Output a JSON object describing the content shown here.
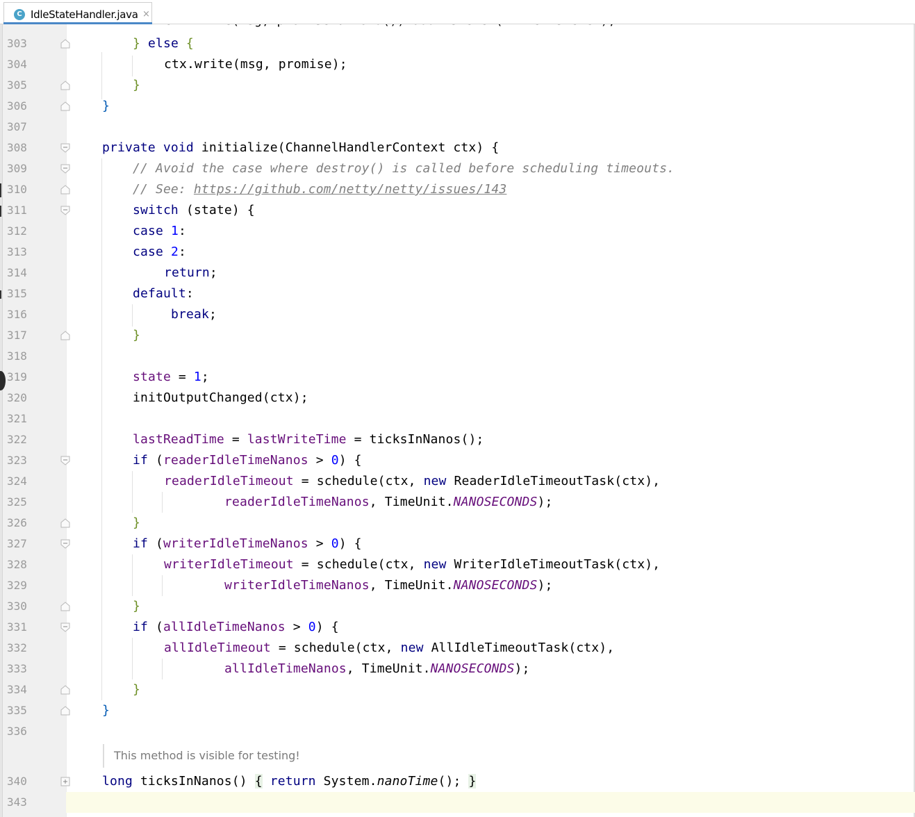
{
  "tab": {
    "icon": "class-icon",
    "icon_letter": "C",
    "file_name": "IdleStateHandler.java",
    "close_glyph": "×"
  },
  "editor": {
    "doc_comment": "This method is visible for testing!",
    "lines": [
      {
        "number": "303"
      },
      {
        "number": "304"
      },
      {
        "number": "305"
      },
      {
        "number": "306"
      },
      {
        "number": "307"
      },
      {
        "number": "308"
      },
      {
        "number": "309"
      },
      {
        "number": "310"
      },
      {
        "number": "311"
      },
      {
        "number": "312"
      },
      {
        "number": "313"
      },
      {
        "number": "314"
      },
      {
        "number": "315"
      },
      {
        "number": "316"
      },
      {
        "number": "317"
      },
      {
        "number": "318"
      },
      {
        "number": "319"
      },
      {
        "number": "320"
      },
      {
        "number": "321"
      },
      {
        "number": "322"
      },
      {
        "number": "323"
      },
      {
        "number": "324"
      },
      {
        "number": "325"
      },
      {
        "number": "326"
      },
      {
        "number": "327"
      },
      {
        "number": "328"
      },
      {
        "number": "329"
      },
      {
        "number": "330"
      },
      {
        "number": "331"
      },
      {
        "number": "332"
      },
      {
        "number": "333"
      },
      {
        "number": "334"
      },
      {
        "number": "335"
      },
      {
        "number": "336"
      },
      {
        "number": "340"
      },
      {
        "number": "343"
      }
    ],
    "code": {
      "l303_a": "} ",
      "l303_kw": "else",
      "l303_b": " {",
      "l304": "ctx.write(msg, promise);",
      "l305": "}",
      "l306": "}",
      "l308_kw1": "private",
      "l308_kw2": "void",
      "l308_rest": " initialize(ChannelHandlerContext ctx) {",
      "l309": "// Avoid the case where destroy() is called before scheduling timeouts.",
      "l310_a": "// See: ",
      "l310_link": "https://github.com/netty/netty/issues/143",
      "l311_kw": "switch",
      "l311_rest": " (state) {",
      "l312_kw": "case",
      "l312_num": "1",
      "l312_b": ":",
      "l313_kw": "case",
      "l313_num": "2",
      "l313_b": ":",
      "l314_kw": "return",
      "l314_b": ";",
      "l315_kw": "default",
      "l315_b": ":",
      "l316_kw": "break",
      "l316_b": ";",
      "l317": "}",
      "l319_fld": "state",
      "l319_a": " = ",
      "l319_num": "1",
      "l319_b": ";",
      "l320": "initOutputChanged(ctx);",
      "l322_f1": "lastReadTime",
      "l322_a": " = ",
      "l322_f2": "lastWriteTime",
      "l322_b": " = ticksInNanos();",
      "l323_kw": "if",
      "l323_a": " (",
      "l323_fld": "readerIdleTimeNanos",
      "l323_b": " > ",
      "l323_num": "0",
      "l323_c": ") {",
      "l324_fld": "readerIdleTimeout",
      "l324_a": " = schedule(ctx, ",
      "l324_kw": "new",
      "l324_b": " ReaderIdleTimeoutTask(ctx),",
      "l325_fld": "readerIdleTimeNanos",
      "l325_a": ", TimeUnit.",
      "l325_stat": "NANOSECONDS",
      "l325_b": ");",
      "l326": "}",
      "l327_kw": "if",
      "l327_a": " (",
      "l327_fld": "writerIdleTimeNanos",
      "l327_b": " > ",
      "l327_num": "0",
      "l327_c": ") {",
      "l328_fld": "writerIdleTimeout",
      "l328_a": " = schedule(ctx, ",
      "l328_kw": "new",
      "l328_b": " WriterIdleTimeoutTask(ctx),",
      "l329_fld": "writerIdleTimeNanos",
      "l329_a": ", TimeUnit.",
      "l329_stat": "NANOSECONDS",
      "l329_b": ");",
      "l330": "}",
      "l331_kw": "if",
      "l331_a": " (",
      "l331_fld": "allIdleTimeNanos",
      "l331_b": " > ",
      "l331_num": "0",
      "l331_c": ") {",
      "l332_fld": "allIdleTimeout",
      "l332_a": " = schedule(ctx, ",
      "l332_kw": "new",
      "l332_b": " AllIdleTimeoutTask(ctx),",
      "l333_fld": "allIdleTimeNanos",
      "l333_a": ", TimeUnit.",
      "l333_stat": "NANOSECONDS",
      "l333_b": ");",
      "l334": "}",
      "l335": "}",
      "l340_kw1": "long",
      "l340_a": " ticksInNanos() ",
      "l340_ob": "{",
      "l340_sp": " ",
      "l340_kw2": "return",
      "l340_b": " System.",
      "l340_mth": "nanoTime",
      "l340_c": "(); ",
      "l340_cb": "}"
    }
  },
  "colors": {
    "keyword": "#000080",
    "field": "#660e7a",
    "number": "#0000ff",
    "comment": "#808080",
    "gutter": "#f0f0f0",
    "tab_accent": "#4a88c7"
  }
}
